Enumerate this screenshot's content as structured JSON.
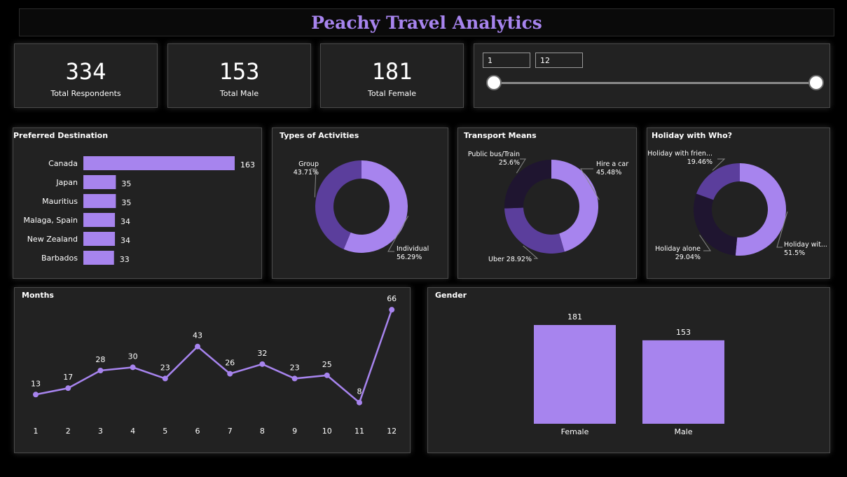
{
  "title": "Peachy Travel Analytics",
  "kpis": [
    {
      "value": "334",
      "label": "Total Respondents"
    },
    {
      "value": "153",
      "label": "Total Male"
    },
    {
      "value": "181",
      "label": "Total Female"
    }
  ],
  "month_filter": {
    "from": "1",
    "to": "12"
  },
  "colors": {
    "accent": "#a784ee",
    "mid": "#5b3e9c",
    "dark": "#1f1530",
    "panel": "#222222"
  },
  "chart_data": [
    {
      "id": "destination",
      "type": "bar",
      "title": "Preferred Destination",
      "orientation": "horizontal",
      "categories": [
        "Canada",
        "Japan",
        "Mauritius",
        "Malaga, Spain",
        "New Zealand",
        "Barbados"
      ],
      "values": [
        163,
        35,
        35,
        34,
        34,
        33
      ],
      "xlim": [
        0,
        163
      ]
    },
    {
      "id": "activities",
      "type": "pie",
      "title": "Types of Activities",
      "donut": true,
      "slices": [
        {
          "label": "Individual",
          "pct_text": "56.29%",
          "value": 56.29,
          "color": "#a784ee"
        },
        {
          "label": "Group",
          "pct_text": "43.71%",
          "value": 43.71,
          "color": "#5b3e9c"
        }
      ]
    },
    {
      "id": "transport",
      "type": "pie",
      "title": "Transport Means",
      "donut": true,
      "slices": [
        {
          "label": "Hire a car",
          "pct_text": "45.48%",
          "value": 45.48,
          "color": "#a784ee"
        },
        {
          "label": "Uber",
          "pct_text": "28.92%",
          "value": 28.92,
          "color": "#5b3e9c"
        },
        {
          "label": "Public bus/Train",
          "pct_text": "25.6%",
          "value": 25.6,
          "color": "#1f1530"
        }
      ]
    },
    {
      "id": "holiday",
      "type": "pie",
      "title": "Holiday with Who?",
      "donut": true,
      "slices": [
        {
          "label": "Holiday wit...",
          "pct_text": "51.5%",
          "value": 51.5,
          "color": "#a784ee"
        },
        {
          "label": "Holiday alone",
          "pct_text": "29.04%",
          "value": 29.04,
          "color": "#1f1530"
        },
        {
          "label": "Holiday with frien...",
          "pct_text": "19.46%",
          "value": 19.46,
          "color": "#5b3e9c"
        }
      ]
    },
    {
      "id": "months",
      "type": "line",
      "title": "Months",
      "x": [
        1,
        2,
        3,
        4,
        5,
        6,
        7,
        8,
        9,
        10,
        11,
        12
      ],
      "values": [
        13,
        17,
        28,
        30,
        23,
        43,
        26,
        32,
        23,
        25,
        8,
        66
      ],
      "ylim": [
        0,
        70
      ]
    },
    {
      "id": "gender",
      "type": "bar",
      "title": "Gender",
      "categories": [
        "Female",
        "Male"
      ],
      "values": [
        181,
        153
      ],
      "ylim": [
        0,
        181
      ]
    }
  ]
}
